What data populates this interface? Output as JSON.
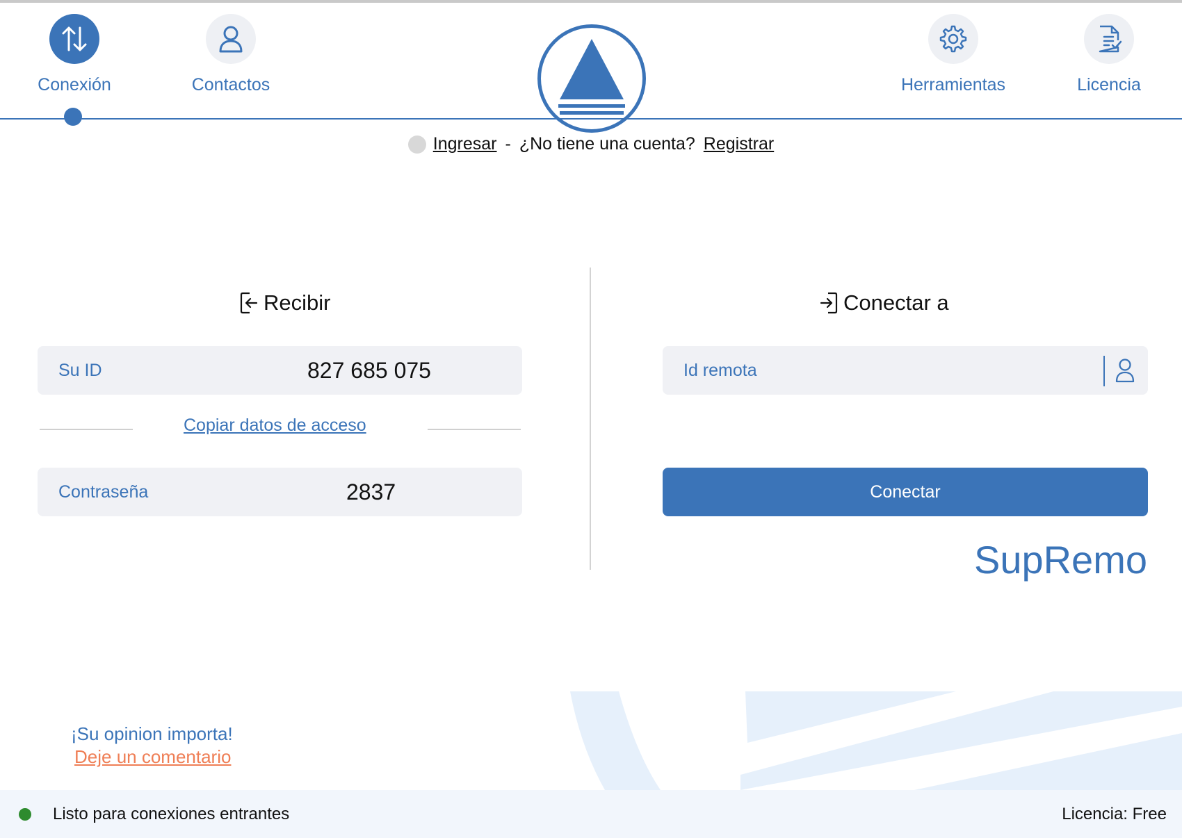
{
  "nav": {
    "items": [
      {
        "label": "Conexión",
        "icon": "arrows-up-down-icon",
        "active": true
      },
      {
        "label": "Contactos",
        "icon": "user-icon",
        "active": false
      },
      {
        "label": "Herramientas",
        "icon": "gear-icon",
        "active": false
      },
      {
        "label": "Licencia",
        "icon": "document-check-icon",
        "active": false
      }
    ]
  },
  "account": {
    "login": "Ingresar",
    "separator": "-",
    "question": "¿No tiene una cuenta?",
    "register": "Registrar"
  },
  "receive": {
    "title": "Recibir",
    "id_label": "Su ID",
    "id_value": "827 685 075",
    "copy_link": "Copiar datos de acceso",
    "password_label": "Contraseña",
    "password_value": "2837"
  },
  "connect": {
    "title": "Conectar a",
    "remote_placeholder": "Id remota",
    "button": "Conectar",
    "brand": "SupRemo"
  },
  "feedback": {
    "line1": "¡Su opinion importa!",
    "line2": "Deje un comentario"
  },
  "status": {
    "text": "Listo para conexiones entrantes",
    "license": "Licencia: Free"
  },
  "colors": {
    "accent": "#3b74b8",
    "link_orange": "#ef7e55",
    "status_green": "#2e8b2e"
  }
}
